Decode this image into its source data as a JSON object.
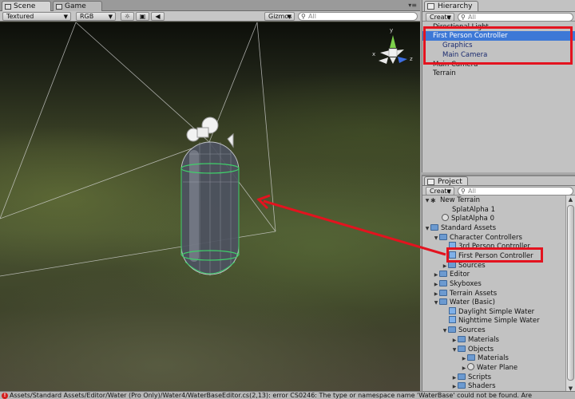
{
  "scene": {
    "tabs": [
      {
        "label": "Scene",
        "active": true
      },
      {
        "label": "Game",
        "active": false
      }
    ],
    "render_mode": "Textured",
    "color_mode": "RGB",
    "gizmos_label": "Gizmos",
    "search_placeholder": "All"
  },
  "hierarchy": {
    "title": "Hierarchy",
    "create_label": "Create",
    "search_placeholder": "All",
    "items": [
      {
        "label": "Directional Light",
        "depth": 0,
        "selected": false
      },
      {
        "label": "First Person Controller",
        "depth": 0,
        "selected": true
      },
      {
        "label": "Graphics",
        "depth": 1,
        "selected": false
      },
      {
        "label": "Main Camera",
        "depth": 1,
        "selected": false
      },
      {
        "label": "Main Camera",
        "depth": 0,
        "selected": false
      },
      {
        "label": "Terrain",
        "depth": 0,
        "selected": false
      }
    ]
  },
  "project": {
    "title": "Project",
    "create_label": "Create",
    "search_placeholder": "All",
    "items": [
      {
        "label": "New Terrain",
        "depth": 0,
        "icon": "unity-asset-icon",
        "expand": "open"
      },
      {
        "label": "SplatAlpha 1",
        "depth": 1,
        "icon": "none",
        "expand": ""
      },
      {
        "label": "SplatAlpha 0",
        "depth": 1,
        "icon": "circle-icon",
        "expand": ""
      },
      {
        "label": "Standard Assets",
        "depth": 0,
        "icon": "folder-icon",
        "expand": "open"
      },
      {
        "label": "Character Controllers",
        "depth": 1,
        "icon": "folder-icon",
        "expand": "open"
      },
      {
        "label": "3rd Person Controller",
        "depth": 2,
        "icon": "prefab-icon",
        "expand": ""
      },
      {
        "label": "First Person Controller",
        "depth": 2,
        "icon": "prefab-icon",
        "expand": ""
      },
      {
        "label": "Sources",
        "depth": 2,
        "icon": "folder-icon",
        "expand": "closed"
      },
      {
        "label": "Editor",
        "depth": 1,
        "icon": "folder-icon",
        "expand": "closed"
      },
      {
        "label": "Skyboxes",
        "depth": 1,
        "icon": "folder-icon",
        "expand": "closed"
      },
      {
        "label": "Terrain Assets",
        "depth": 1,
        "icon": "folder-icon",
        "expand": "closed"
      },
      {
        "label": "Water (Basic)",
        "depth": 1,
        "icon": "folder-icon",
        "expand": "open"
      },
      {
        "label": "Daylight Simple Water",
        "depth": 2,
        "icon": "prefab-icon",
        "expand": ""
      },
      {
        "label": "Nighttime Simple Water",
        "depth": 2,
        "icon": "prefab-icon",
        "expand": ""
      },
      {
        "label": "Sources",
        "depth": 2,
        "icon": "folder-icon",
        "expand": "open"
      },
      {
        "label": "Materials",
        "depth": 3,
        "icon": "folder-icon",
        "expand": "closed"
      },
      {
        "label": "Objects",
        "depth": 3,
        "icon": "folder-icon",
        "expand": "open"
      },
      {
        "label": "Materials",
        "depth": 4,
        "icon": "folder-icon",
        "expand": "closed"
      },
      {
        "label": "Water Plane",
        "depth": 4,
        "icon": "mesh-icon",
        "expand": "closed"
      },
      {
        "label": "Scripts",
        "depth": 3,
        "icon": "folder-icon",
        "expand": "closed"
      },
      {
        "label": "Shaders",
        "depth": 3,
        "icon": "folder-icon",
        "expand": "closed"
      }
    ]
  },
  "status_bar": {
    "message": "Assets/Standard Assets/Editor/Water (Pro Only)/Water4/WaterBaseEditor.cs(2,13): error CS0246: The type or namespace name 'WaterBase' could not be found. Are"
  },
  "colors": {
    "annotation": "#e3131f",
    "selection": "#3d78d6"
  }
}
